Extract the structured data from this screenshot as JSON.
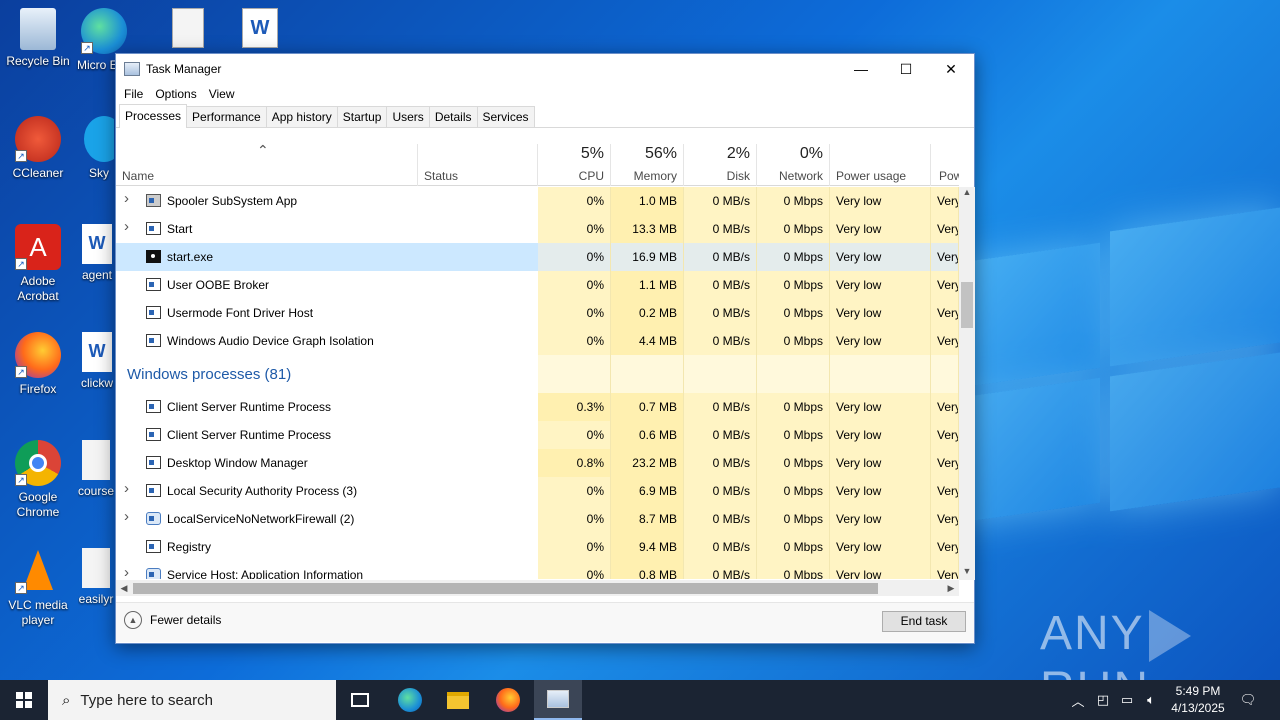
{
  "desktop": {
    "icons": [
      {
        "label": "Recycle Bin"
      },
      {
        "label": "Micro Edg"
      },
      {
        "label": "CCleaner"
      },
      {
        "label": "Sky"
      },
      {
        "label": "Adobe Acrobat"
      },
      {
        "label": "agent"
      },
      {
        "label": "Firefox"
      },
      {
        "label": "clickw"
      },
      {
        "label": "Google Chrome"
      },
      {
        "label": "course"
      },
      {
        "label": "VLC media player"
      },
      {
        "label": "easilyr"
      }
    ],
    "watermark": "ANY RUN",
    "watermark_left": "ANY",
    "watermark_right": "RUN"
  },
  "window": {
    "title": "Task Manager",
    "minimize": "—",
    "maximize": "☐",
    "close": "✕",
    "menu": [
      "File",
      "Options",
      "View"
    ],
    "tabs": [
      "Processes",
      "Performance",
      "App history",
      "Startup",
      "Users",
      "Details",
      "Services"
    ],
    "active_tab": "Processes",
    "columns": {
      "name": "Name",
      "status": "Status",
      "cpu": {
        "pct": "5%",
        "label": "CPU"
      },
      "memory": {
        "pct": "56%",
        "label": "Memory"
      },
      "disk": {
        "pct": "2%",
        "label": "Disk"
      },
      "network": {
        "pct": "0%",
        "label": "Network"
      },
      "power": "Power usage",
      "power_trend": "Power"
    },
    "rows": [
      {
        "name": "Spooler SubSystem App",
        "expand": true,
        "icon": "printer",
        "cpu": "0%",
        "mem": "1.0 MB",
        "disk": "0 MB/s",
        "net": "0 Mbps",
        "power": "Very low",
        "trend": "Very"
      },
      {
        "name": "Start",
        "expand": true,
        "icon": "window",
        "cpu": "0%",
        "mem": "13.3 MB",
        "disk": "0 MB/s",
        "net": "0 Mbps",
        "power": "Very low",
        "trend": "Very"
      },
      {
        "name": "start.exe",
        "expand": false,
        "icon": "terminal",
        "selected": true,
        "cpu": "0%",
        "mem": "16.9 MB",
        "disk": "0 MB/s",
        "net": "0 Mbps",
        "power": "Very low",
        "trend": "Very"
      },
      {
        "name": "User OOBE Broker",
        "expand": false,
        "icon": "window",
        "cpu": "0%",
        "mem": "1.1 MB",
        "disk": "0 MB/s",
        "net": "0 Mbps",
        "power": "Very low",
        "trend": "Very"
      },
      {
        "name": "Usermode Font Driver Host",
        "expand": false,
        "icon": "window",
        "cpu": "0%",
        "mem": "0.2 MB",
        "disk": "0 MB/s",
        "net": "0 Mbps",
        "power": "Very low",
        "trend": "Very"
      },
      {
        "name": "Windows Audio Device Graph Isolation",
        "expand": false,
        "icon": "window",
        "cpu": "0%",
        "mem": "4.4 MB",
        "disk": "0 MB/s",
        "net": "0 Mbps",
        "power": "Very low",
        "trend": "Very"
      }
    ],
    "group": "Windows processes (81)",
    "rows2": [
      {
        "name": "Client Server Runtime Process",
        "expand": false,
        "icon": "window",
        "cpu": "0.3%",
        "mem": "0.7 MB",
        "disk": "0 MB/s",
        "net": "0 Mbps",
        "power": "Very low",
        "trend": "Very"
      },
      {
        "name": "Client Server Runtime Process",
        "expand": false,
        "icon": "window",
        "cpu": "0%",
        "mem": "0.6 MB",
        "disk": "0 MB/s",
        "net": "0 Mbps",
        "power": "Very low",
        "trend": "Very"
      },
      {
        "name": "Desktop Window Manager",
        "expand": false,
        "icon": "window",
        "cpu": "0.8%",
        "mem": "23.2 MB",
        "disk": "0 MB/s",
        "net": "0 Mbps",
        "power": "Very low",
        "trend": "Very"
      },
      {
        "name": "Local Security Authority Process (3)",
        "expand": true,
        "icon": "window",
        "cpu": "0%",
        "mem": "6.9 MB",
        "disk": "0 MB/s",
        "net": "0 Mbps",
        "power": "Very low",
        "trend": "Very"
      },
      {
        "name": "LocalServiceNoNetworkFirewall (2)",
        "expand": true,
        "icon": "gear",
        "cpu": "0%",
        "mem": "8.7 MB",
        "disk": "0 MB/s",
        "net": "0 Mbps",
        "power": "Very low",
        "trend": "Very"
      },
      {
        "name": "Registry",
        "expand": false,
        "icon": "window",
        "cpu": "0%",
        "mem": "9.4 MB",
        "disk": "0 MB/s",
        "net": "0 Mbps",
        "power": "Very low",
        "trend": "Very"
      },
      {
        "name": "Service Host: Application Information",
        "expand": true,
        "icon": "gear",
        "cpu": "0%",
        "mem": "0.8 MB",
        "disk": "0 MB/s",
        "net": "0 Mbps",
        "power": "Very low",
        "trend": "Very"
      }
    ],
    "fewer_details": "Fewer details",
    "end_task": "End task"
  },
  "taskbar": {
    "search_placeholder": "Type here to search",
    "time": "5:49 PM",
    "date": "4/13/2025"
  }
}
